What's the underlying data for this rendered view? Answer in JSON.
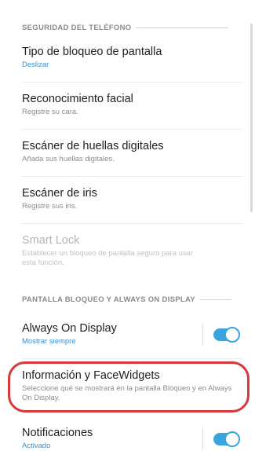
{
  "sections": {
    "security_header": "SEGURIDAD DEL TELÉFONO",
    "lock_header": "PANTALLA BLOQUEO Y ALWAYS ON DISPLAY"
  },
  "items": {
    "screen_lock": {
      "title": "Tipo de bloqueo de pantalla",
      "subtitle": "Deslizar"
    },
    "face": {
      "title": "Reconocimiento facial",
      "subtitle": "Registre su cara."
    },
    "fingerprint": {
      "title": "Escáner de huellas digitales",
      "subtitle": "Añada sus huellas digitales."
    },
    "iris": {
      "title": "Escáner de iris",
      "subtitle": "Registre sus iris."
    },
    "smart_lock": {
      "title": "Smart Lock",
      "subtitle": "Establecer un bloqueo de pantalla seguro para usar esta función."
    },
    "aod": {
      "title": "Always On Display",
      "subtitle": "Mostrar siempre",
      "toggle_on": true
    },
    "facewidgets": {
      "title": "Información y FaceWidgets",
      "subtitle": "Seleccione qué se mostrará en la pantalla Bloqueo y en Always On Display."
    },
    "notifications": {
      "title": "Notificaciones",
      "subtitle": "Activado",
      "toggle_on": true
    }
  },
  "colors": {
    "accent": "#3a8fcf",
    "toggle": "#3aa4de",
    "highlight": "#d9383a"
  }
}
